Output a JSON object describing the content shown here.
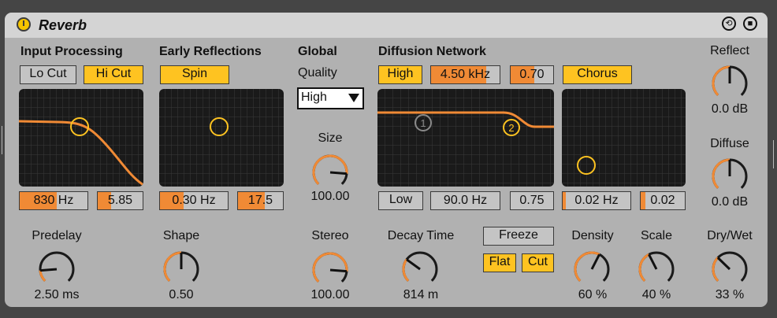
{
  "device": {
    "title": "Reverb"
  },
  "input_processing": {
    "title": "Input Processing",
    "lo_cut_label": "Lo Cut",
    "hi_cut_label": "Hi Cut",
    "freq": {
      "value": "830 Hz",
      "level": 0.55
    },
    "width": {
      "value": "5.85",
      "level": 0.3
    }
  },
  "early_reflections": {
    "title": "Early Reflections",
    "spin_label": "Spin",
    "amount": {
      "value": "0.30 Hz",
      "level": 0.35
    },
    "depth": {
      "value": "17.5",
      "level": 0.6
    }
  },
  "global": {
    "title": "Global",
    "quality_label": "Quality",
    "quality_value": "High",
    "size_label": "Size",
    "size_value": "100.00",
    "size_level": 0.85,
    "stereo_label": "Stereo",
    "stereo_value": "100.00",
    "stereo_level": 0.85
  },
  "diffusion": {
    "title": "Diffusion Network",
    "high_label": "High",
    "freq": {
      "value": "4.50 kHz",
      "level": 0.8
    },
    "ratio": {
      "value": "0.70",
      "level": 0.55
    },
    "chorus_label": "Chorus",
    "low_label": "Low",
    "low_freq": {
      "value": "90.0 Hz",
      "level": 0
    },
    "low_ratio": {
      "value": "0.75",
      "level": 0
    },
    "chorus_rate": {
      "value": "0.02 Hz",
      "level": 0.05
    },
    "chorus_amount": {
      "value": "0.02",
      "level": 0.1
    },
    "point1_label": "1",
    "point2_label": "2"
  },
  "reflect": {
    "label": "Reflect",
    "value": "0.0 dB",
    "level": 0.5
  },
  "diffuse": {
    "label": "Diffuse",
    "value": "0.0 dB",
    "level": 0.5
  },
  "predelay": {
    "label": "Predelay",
    "value": "2.50 ms",
    "level": 0.15
  },
  "shape": {
    "label": "Shape",
    "value": "0.50",
    "level": 0.5
  },
  "decay": {
    "label": "Decay Time",
    "value": "814 m",
    "level": 0.3
  },
  "freeze": {
    "label": "Freeze",
    "flat_label": "Flat",
    "cut_label": "Cut"
  },
  "density": {
    "label": "Density",
    "value": "60 %",
    "level": 0.6
  },
  "scale": {
    "label": "Scale",
    "value": "40 %",
    "level": 0.4
  },
  "drywet": {
    "label": "Dry/Wet",
    "value": "33 %",
    "level": 0.33
  },
  "colors": {
    "accent": "#f08a35",
    "button_on": "#fec321",
    "panel": "#b1b1b1",
    "graph_bg": "#1a1a1a"
  }
}
